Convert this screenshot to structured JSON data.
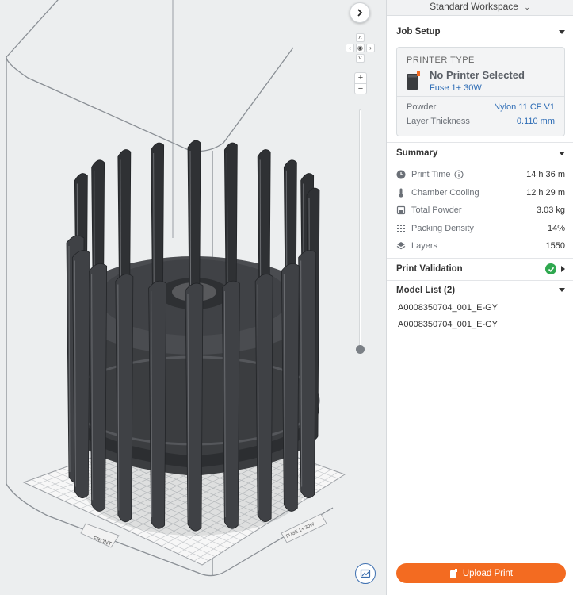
{
  "workspace": {
    "label": "Standard Workspace"
  },
  "viewport": {
    "build_plate": {
      "front_label": "FRONT",
      "brand_label": "FUSE 1+ 30W"
    }
  },
  "job_setup": {
    "title": "Job Setup",
    "printer_type_label": "PRINTER TYPE",
    "printer_status": "No Printer Selected",
    "printer_model": "Fuse 1+ 30W",
    "powder_label": "Powder",
    "powder_value": "Nylon 11 CF V1",
    "layer_label": "Layer Thickness",
    "layer_value": "0.110 mm"
  },
  "summary": {
    "title": "Summary",
    "rows": [
      {
        "icon": "clock-icon",
        "label": "Print Time",
        "value": "14 h 36 m"
      },
      {
        "icon": "thermometer-icon",
        "label": "Chamber Cooling",
        "value": "12 h 29 m"
      },
      {
        "icon": "powder-icon",
        "label": "Total Powder",
        "value": "3.03 kg"
      },
      {
        "icon": "packing-density-icon",
        "label": "Packing Density",
        "value": "14%"
      },
      {
        "icon": "layers-icon",
        "label": "Layers",
        "value": "1550"
      }
    ]
  },
  "validation": {
    "title": "Print Validation",
    "status": "ok"
  },
  "model_list": {
    "title": "Model List (2)",
    "items": [
      "A0008350704_001_E-GY",
      "A0008350704_001_E-GY"
    ]
  },
  "actions": {
    "upload_label": "Upload Print"
  },
  "colors": {
    "accent": "#f36b21",
    "link": "#2d6cb5",
    "success": "#2fa84f"
  }
}
